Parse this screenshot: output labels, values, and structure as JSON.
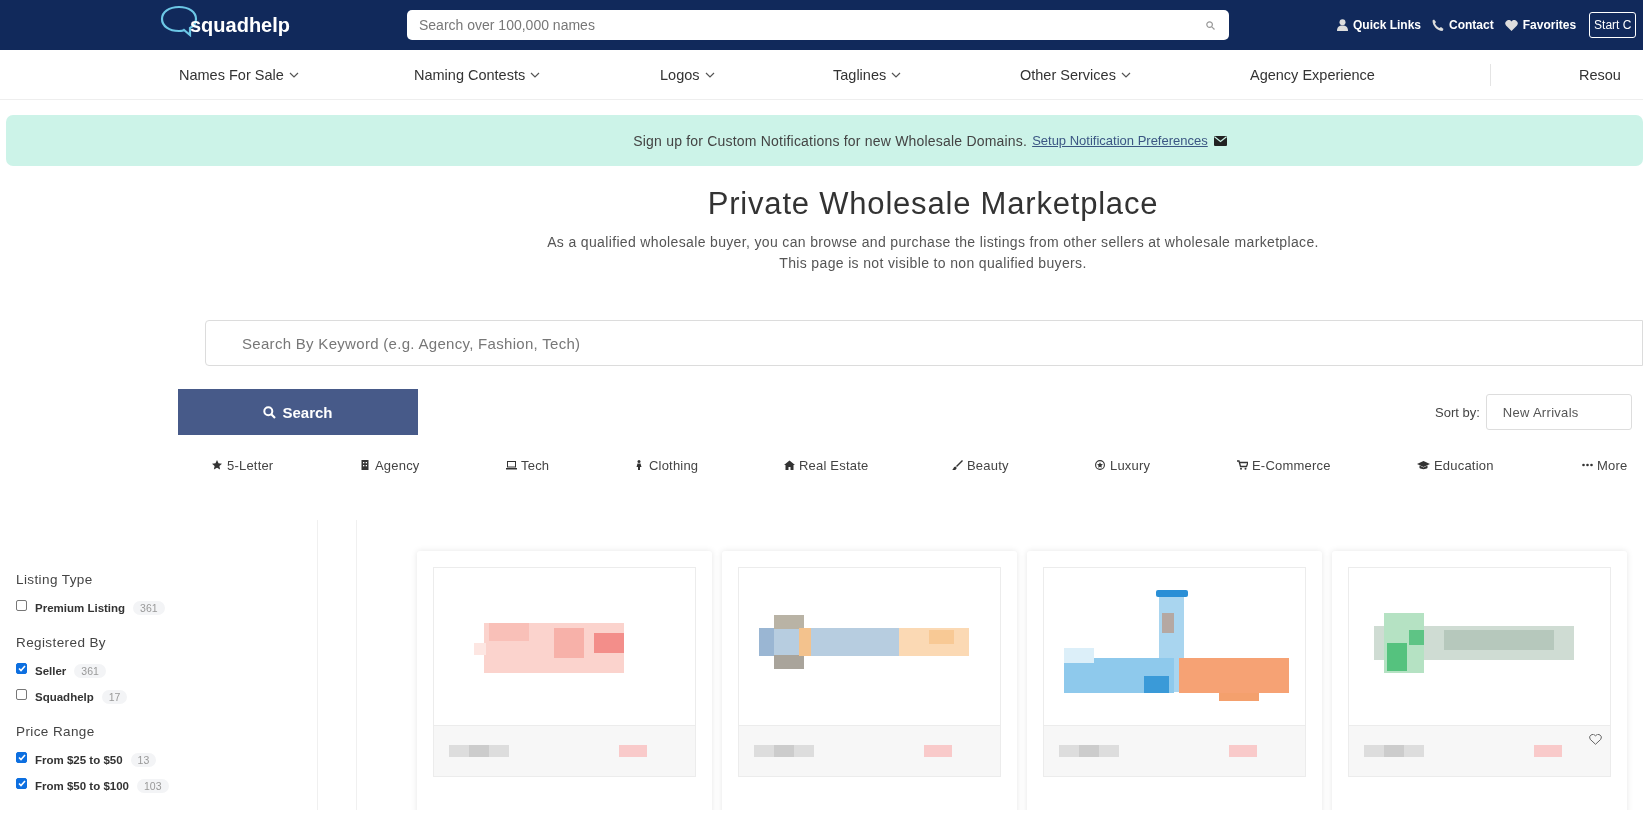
{
  "header": {
    "logo": "squadhelp",
    "search": {
      "placeholder": "Search over 100,000 names"
    },
    "links": [
      {
        "label": "Quick Links"
      },
      {
        "label": "Contact"
      },
      {
        "label": "Favorites"
      }
    ],
    "start_button": "Start C"
  },
  "nav": {
    "items": [
      {
        "label": "Names For Sale",
        "dropdown": true
      },
      {
        "label": "Naming Contests",
        "dropdown": true
      },
      {
        "label": "Logos",
        "dropdown": true
      },
      {
        "label": "Taglines",
        "dropdown": true
      },
      {
        "label": "Other Services",
        "dropdown": true
      },
      {
        "label": "Agency Experience",
        "dropdown": false
      },
      {
        "label": "Resou",
        "dropdown": false
      }
    ]
  },
  "notice": {
    "text": "Sign up for Custom Notifications for new Wholesale Domains.",
    "link": "Setup Notification Preferences"
  },
  "title": "Private Wholesale Marketplace",
  "subtitle": [
    "As a qualified wholesale buyer, you can browse and purchase the listings from other sellers at wholesale marketplace.",
    "This page is not visible to non qualified buyers."
  ],
  "keyword_search": {
    "placeholder": "Search By Keyword (e.g. Agency, Fashion, Tech)"
  },
  "search_button": "Search",
  "sort": {
    "label": "Sort by:",
    "value": "New Arrivals"
  },
  "categories": [
    {
      "label": "5-Letter"
    },
    {
      "label": "Agency"
    },
    {
      "label": "Tech"
    },
    {
      "label": "Clothing"
    },
    {
      "label": "Real Estate"
    },
    {
      "label": "Beauty"
    },
    {
      "label": "Luxury"
    },
    {
      "label": "E-Commerce"
    },
    {
      "label": "Education"
    },
    {
      "label": "More"
    }
  ],
  "filters": [
    {
      "title": "Listing Type",
      "options": [
        {
          "label": "Premium Listing",
          "count": "361",
          "checked": false
        }
      ]
    },
    {
      "title": "Registered By",
      "options": [
        {
          "label": "Seller",
          "count": "361",
          "checked": true
        },
        {
          "label": "Squadhelp",
          "count": "17",
          "checked": false
        }
      ]
    },
    {
      "title": "Price Range",
      "options": [
        {
          "label": "From $25 to $50",
          "count": "13",
          "checked": true
        },
        {
          "label": "From $50 to $100",
          "count": "103",
          "checked": true
        }
      ]
    }
  ],
  "listings": [
    {
      "kind": "picture",
      "favorite": false
    },
    {
      "kind": "picture",
      "favorite": false
    },
    {
      "kind": "picture",
      "favorite": false
    },
    {
      "kind": "picture",
      "favorite": true
    }
  ]
}
